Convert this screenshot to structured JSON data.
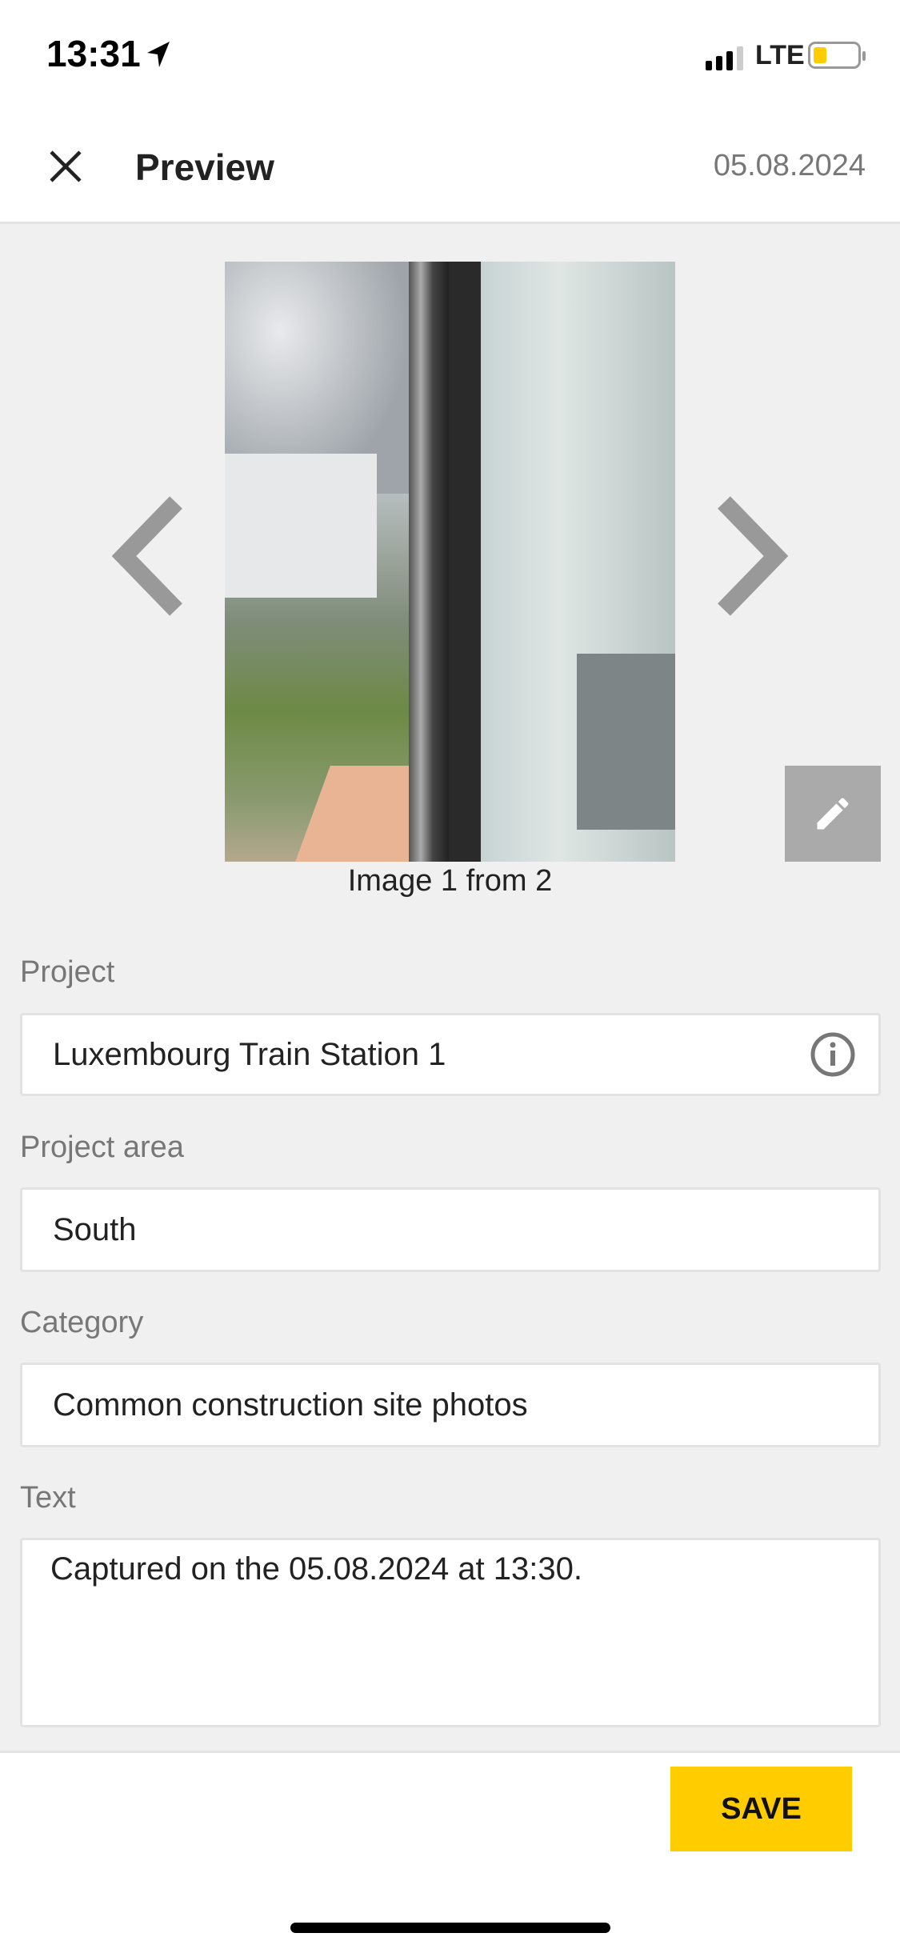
{
  "status_bar": {
    "time": "13:31",
    "network": "LTE",
    "battery_level": 0.2,
    "colors": {
      "battery": "#ffcc00"
    }
  },
  "header": {
    "title": "Preview",
    "date": "05.08.2024"
  },
  "gallery": {
    "caption": "Image 1 from 2"
  },
  "form": {
    "project": {
      "label": "Project",
      "value": "Luxembourg Train Station 1"
    },
    "project_area": {
      "label": "Project area",
      "value": "South"
    },
    "category": {
      "label": "Category",
      "value": "Common construction site photos"
    },
    "text": {
      "label": "Text",
      "value": "Captured on the 05.08.2024 at 13:30."
    }
  },
  "footer": {
    "save_label": "SAVE"
  },
  "colors": {
    "accent": "#ffcc00"
  }
}
